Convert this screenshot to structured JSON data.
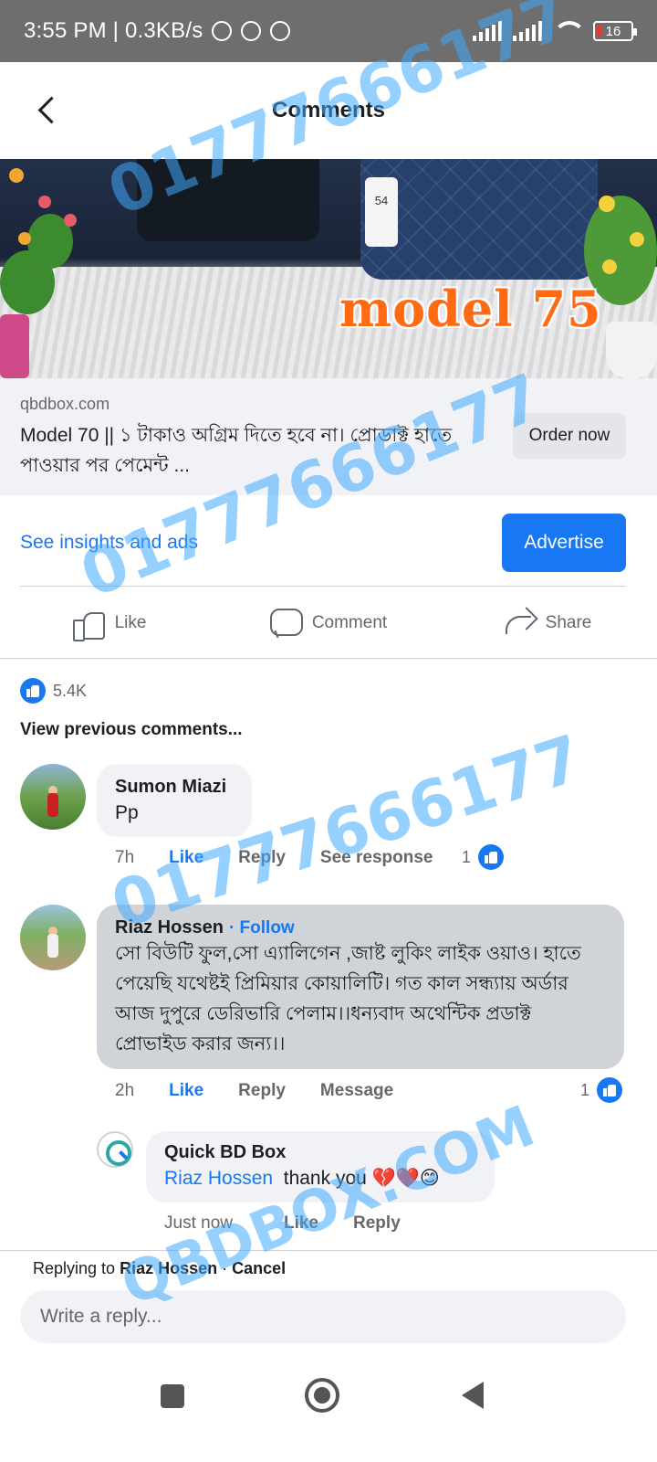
{
  "status_bar": {
    "time": "3:55 PM | 0.3KB/s",
    "battery": "16",
    "icons": [
      "messenger-icon",
      "telegram-icon",
      "sync-icon",
      "signal-icon",
      "signal-icon",
      "wifi-icon",
      "battery-icon"
    ]
  },
  "header": {
    "title": "Comments"
  },
  "ad": {
    "image_overlay_text": "model 75",
    "tag_number": "54",
    "domain": "qbdbox.com",
    "text": "Model 70 || ১ টাকাও অগ্রিম দিতে হবে না।  প্রোডাক্ট হাতে পাওয়ার পর পেমেন্ট ...",
    "order_button": "Order now"
  },
  "insights": {
    "link": "See insights and ads",
    "advertise_button": "Advertise"
  },
  "actions": {
    "like": "Like",
    "comment": "Comment",
    "share": "Share"
  },
  "reactions": {
    "count": "5.4K"
  },
  "view_previous": "View previous comments...",
  "comments": [
    {
      "author": "Sumon Miazi",
      "text": "Pp",
      "time": "7h",
      "like": "Like",
      "reply": "Reply",
      "extra": "See response",
      "reaction_count": "1"
    },
    {
      "author": "Riaz Hossen",
      "follow": "· Follow",
      "text": "সো বিউটি ফুল,সো এ্যালিগেন ,জাষ্ট লুকিং লাইক ওয়াও। হাতে পেয়েছি যথেষ্টই প্রিমিয়ার কোয়ালিটি। গত কাল সন্ধ্যায় অর্ডার আজ দুপুরে ডেরিভারি পেলাম।।ধন্যবাদ অথেন্টিক প্রডাক্ট প্রোভাইড করার জন্য।।",
      "time": "2h",
      "like": "Like",
      "reply": "Reply",
      "extra": "Message",
      "reaction_count": "1"
    }
  ],
  "reply": {
    "author": "Quick BD Box",
    "mention": "Riaz Hossen",
    "text": "thank you 💔❤️😊",
    "time": "Just now",
    "like": "Like",
    "reply": "Reply"
  },
  "reply_bar": {
    "prefix": "Replying to",
    "name": "Riaz Hossen",
    "separator": "·",
    "cancel": "Cancel",
    "placeholder": "Write a reply..."
  },
  "watermarks": {
    "phone": "01777666177",
    "site": "QBDBOX.COM"
  },
  "colors": {
    "brand_blue": "#1877f2",
    "status_bar": "#6e6e6e",
    "watermark": "#40aaff"
  }
}
